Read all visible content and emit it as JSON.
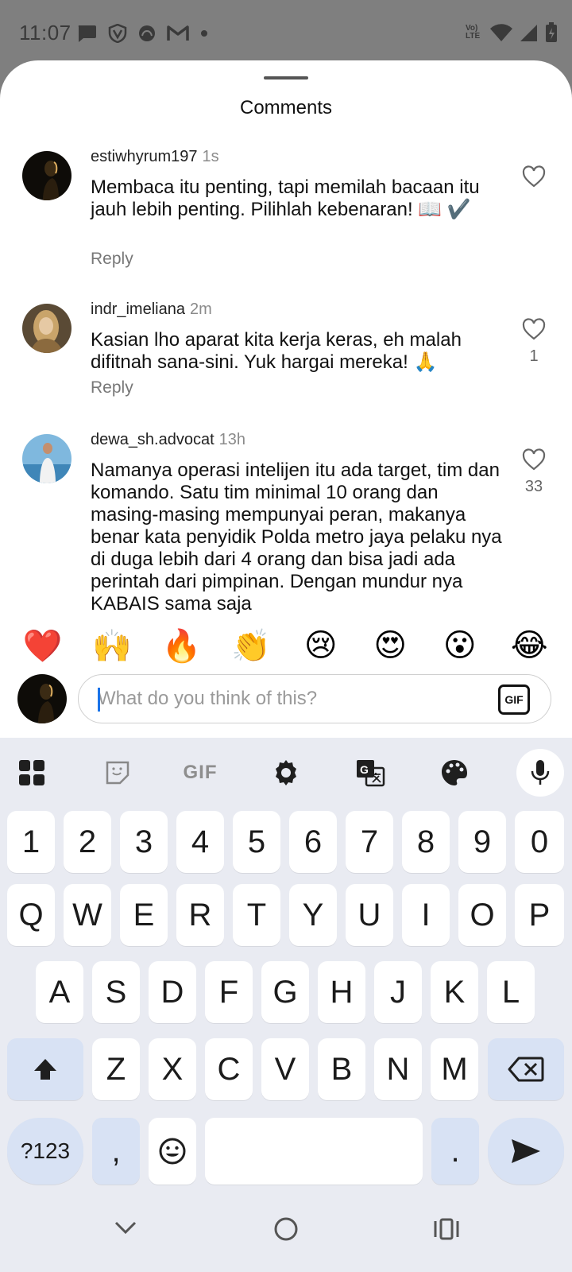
{
  "status_bar": {
    "time": "11:07",
    "network_label": "Vo) LTE"
  },
  "sheet": {
    "title": "Comments"
  },
  "comments": [
    {
      "user": "estiwhyrum197",
      "time": "1s",
      "body": "Membaca itu penting, tapi memilah bacaan itu jauh lebih penting. Pilihlah kebenaran! 📖 ✔️",
      "reply": "Reply",
      "likes": ""
    },
    {
      "user": "indr_imeliana",
      "time": "2m",
      "body": "Kasian lho aparat kita kerja keras, eh malah difitnah sana-sini. Yuk hargai mereka! 🙏",
      "reply": "Reply",
      "likes": "1"
    },
    {
      "user": "dewa_sh.advocat",
      "time": "13h",
      "body": "Namanya operasi intelijen itu ada target, tim dan komando. Satu tim minimal 10 orang dan masing-masing mempunyai peran, makanya benar kata penyidik Polda metro jaya pelaku nya di duga lebih dari 4 orang dan bisa jadi ada perintah dari pimpinan. Dengan mundur nya KABAIS sama saja",
      "reply": "",
      "likes": "33"
    }
  ],
  "quick_emojis": [
    "❤️",
    "🙌",
    "🔥",
    "👏",
    "😢",
    "😍",
    "😮",
    "😂"
  ],
  "composer": {
    "placeholder": "What do you think of this?",
    "value": "",
    "gif_label": "GIF"
  },
  "keyboard": {
    "toolbar_gif": "GIF",
    "number_row": [
      "1",
      "2",
      "3",
      "4",
      "5",
      "6",
      "7",
      "8",
      "9",
      "0"
    ],
    "row1": [
      "Q",
      "W",
      "E",
      "R",
      "T",
      "Y",
      "U",
      "I",
      "O",
      "P"
    ],
    "row2": [
      "A",
      "S",
      "D",
      "F",
      "G",
      "H",
      "J",
      "K",
      "L"
    ],
    "row3": [
      "Z",
      "X",
      "C",
      "V",
      "B",
      "N",
      "M"
    ],
    "symbols_key": "?123",
    "comma_key": ",",
    "period_key": "."
  },
  "colors": {
    "accent": "#1a73e8",
    "function_key": "#d8e2f4",
    "keyboard_bg": "#e9ebf2"
  }
}
